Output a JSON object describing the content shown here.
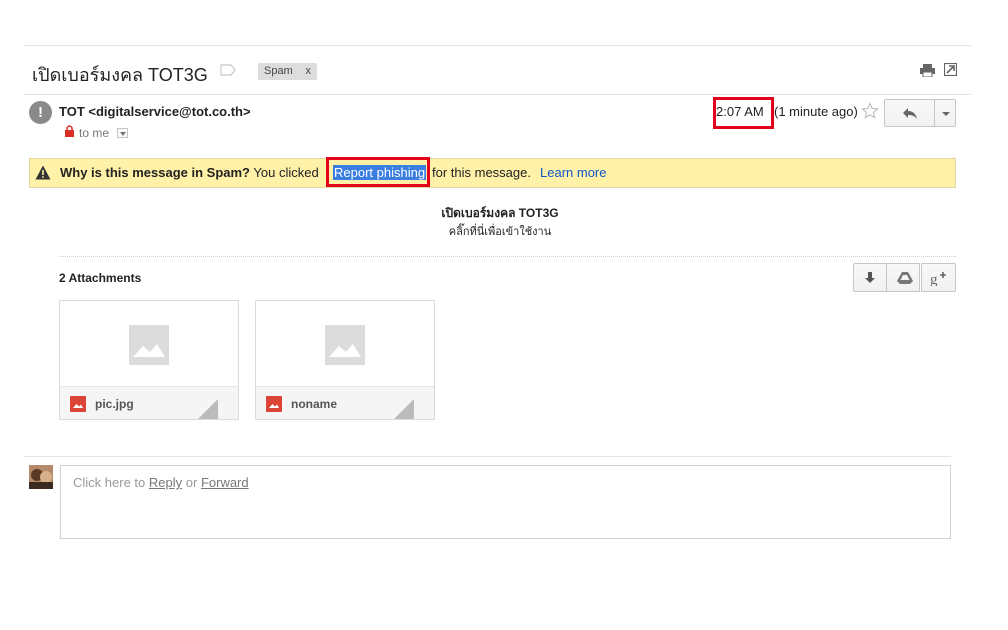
{
  "subject": "เปิดเบอร์มงคล TOT3G",
  "labels": {
    "spam": "Spam",
    "remove": "x"
  },
  "sender": {
    "display": "TOT <digitalservice@tot.co.th>",
    "to": "to me"
  },
  "time": {
    "clock": "2:07 AM",
    "ago": "(1 minute ago)"
  },
  "banner": {
    "question": "Why is this message in Spam?",
    "before": "You clicked",
    "link": "Report phishing",
    "after": "for this message.",
    "learn_more": "Learn more"
  },
  "body": {
    "title": "เปิดเบอร์มงคล TOT3G",
    "line": "คลิ๊กที่นี่เพื่อเข้าใช้งาน"
  },
  "attachments": {
    "title": "2 Attachments",
    "files": [
      {
        "name": "pic.jpg"
      },
      {
        "name": "noname"
      }
    ]
  },
  "reply": {
    "prefix": "Click here to",
    "reply_link": "Reply",
    "or": "or",
    "forward_link": "Forward"
  },
  "icons": [
    "label-icon",
    "print-icon",
    "new-window-icon",
    "warning-avatar-icon",
    "lock-icon",
    "star-icon",
    "reply-icon",
    "warning-triangle-icon",
    "download-icon",
    "drive-icon",
    "google-plus-icon",
    "image-placeholder-icon",
    "file-image-icon"
  ],
  "colors": {
    "banner": "#fff1a8",
    "highlight_box": "#e3001b",
    "link": "#1155cc",
    "selection": "#3a7ee2"
  }
}
